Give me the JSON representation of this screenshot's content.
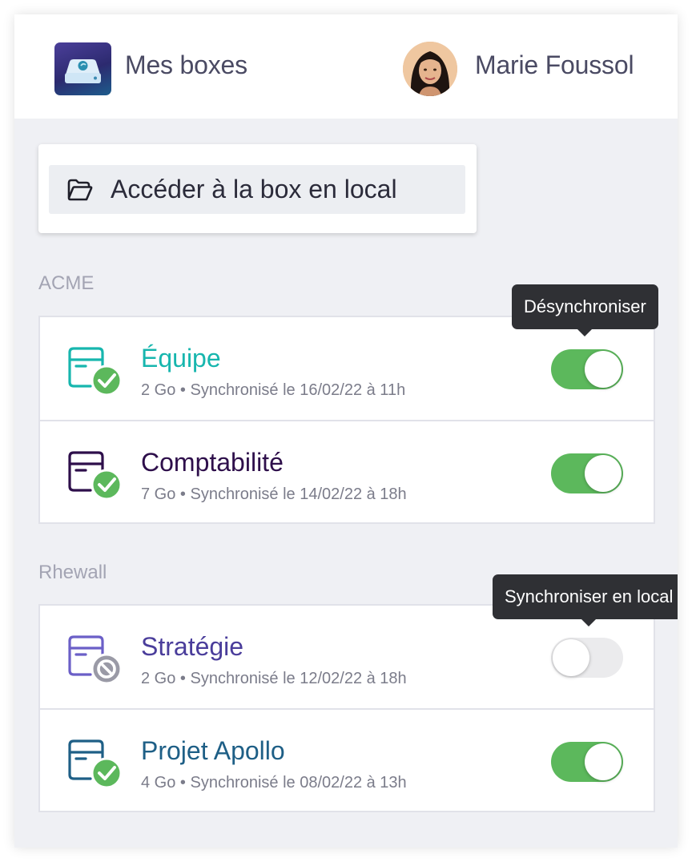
{
  "header": {
    "app_title": "Mes boxes",
    "user_name": "Marie Foussol"
  },
  "access": {
    "label": "Accéder à la box en local"
  },
  "groups": [
    {
      "name": "ACME",
      "tooltip": "Désynchroniser",
      "items": [
        {
          "title": "Équipe",
          "meta": "2 Go • Synchronisé le 16/02/22 à 11h",
          "synced": true,
          "title_color": "#17b6ae",
          "icon_color": "#17b6ae",
          "badge": "check"
        },
        {
          "title": "Comptabilité",
          "meta": "7 Go • Synchronisé le 14/02/22 à 18h",
          "synced": true,
          "title_color": "#2e0f4b",
          "icon_color": "#2e0f4b",
          "badge": "check"
        }
      ]
    },
    {
      "name": "Rhewall",
      "tooltip": "Synchroniser en local",
      "items": [
        {
          "title": "Stratégie",
          "meta": "2 Go • Synchronisé le 12/02/22 à 18h",
          "synced": false,
          "title_color": "#4a3d9b",
          "icon_color": "#6b5fc7",
          "badge": "blocked"
        },
        {
          "title": "Projet Apollo",
          "meta": "4 Go • Synchronisé le 08/02/22 à 13h",
          "synced": true,
          "title_color": "#1e5f86",
          "icon_color": "#1e5f86",
          "badge": "check"
        }
      ]
    }
  ],
  "colors": {
    "toggle_on": "#5cb85c",
    "toggle_off": "#ebebed",
    "check_badge": "#5cb85c",
    "blocked_badge": "#9a9aa6"
  },
  "icons": {
    "app_logo": "drive-logo-icon",
    "access": "folder-open-icon",
    "box": "box-folder-icon",
    "synced": "check-circle-icon",
    "not_synced": "blocked-circle-icon"
  }
}
